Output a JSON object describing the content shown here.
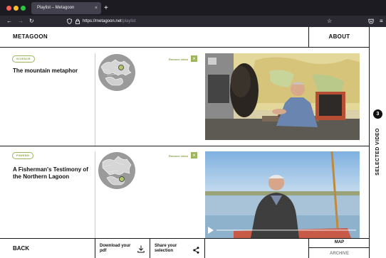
{
  "browser": {
    "tab_title": "Playlist – Metagoon",
    "tab_close": "×",
    "new_tab": "+",
    "url_host": "https://metagoon.net",
    "url_path": "/playlist",
    "colors": {
      "close": "#ff5f57",
      "minimize": "#febc2e",
      "maximize": "#28c840"
    }
  },
  "header": {
    "logo": "METAGOON",
    "about": "ABOUT"
  },
  "videos": [
    {
      "tag": "SCIENCE",
      "title": "The mountain metaphor",
      "remove_label": "Remove video"
    },
    {
      "tag": "FISHING",
      "title": "A Fisherman's Testimony of the Northern Lagoon",
      "remove_label": "Remove video"
    }
  ],
  "footer": {
    "back": "BACK",
    "download": "Download your pdf",
    "share": "Share your selection",
    "map": "MAP",
    "archive": "ARCHIVE"
  },
  "sidebar": {
    "count": "3",
    "label": "SELECTED VIDEO"
  },
  "accent": "#9db55a"
}
